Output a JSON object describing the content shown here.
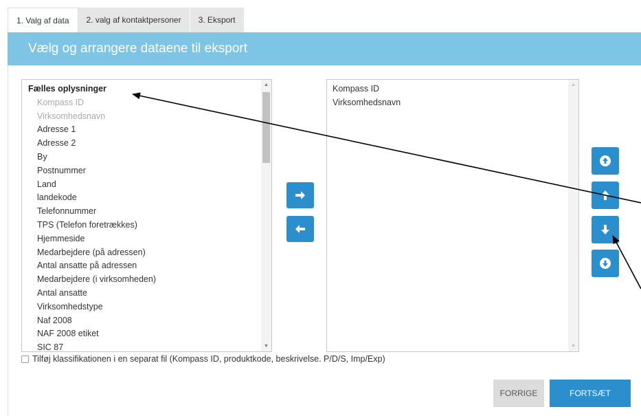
{
  "tabs": [
    {
      "label": "1. Valg af data",
      "active": true
    },
    {
      "label": "2. valg af kontaktpersoner",
      "active": false
    },
    {
      "label": "3. Eksport",
      "active": false
    }
  ],
  "header": {
    "title": "Vælg og arrangere dataene til eksport"
  },
  "available": {
    "group": "Fælles oplysninger",
    "items": [
      {
        "label": "Kompass ID",
        "dim": true
      },
      {
        "label": "Virksomhedsnavn",
        "dim": true
      },
      {
        "label": "Adresse 1"
      },
      {
        "label": "Adresse 2"
      },
      {
        "label": "By"
      },
      {
        "label": "Postnummer"
      },
      {
        "label": "Land"
      },
      {
        "label": "landekode"
      },
      {
        "label": "Telefonnummer"
      },
      {
        "label": "TPS (Telefon foretrækkes)"
      },
      {
        "label": "Hjemmeside"
      },
      {
        "label": "Medarbejdere (på adressen)"
      },
      {
        "label": "Antal ansatte på adressen"
      },
      {
        "label": "Medarbejdere (i virksomheden)"
      },
      {
        "label": "Antal ansatte"
      },
      {
        "label": "Virksomhedstype"
      },
      {
        "label": "Naf 2008"
      },
      {
        "label": "NAF 2008 etiket"
      },
      {
        "label": "SIC 87"
      }
    ]
  },
  "selected": {
    "items": [
      {
        "label": "Kompass ID"
      },
      {
        "label": "Virksomhedsnavn"
      }
    ]
  },
  "icons": {
    "move_right": "arrow-right-icon",
    "move_left": "arrow-left-icon",
    "move_top": "arrow-circle-up-icon",
    "move_up": "arrow-up-icon",
    "move_down": "arrow-down-icon",
    "move_bottom": "arrow-circle-down-icon"
  },
  "checkbox": {
    "label": "Tilføj klassifikationen i en separat fil (Kompass ID, produktkode, beskrivelse. P/D/S, Imp/Exp)",
    "checked": false
  },
  "buttons": {
    "prev": "FORRIGE",
    "next": "FORTSÆT"
  },
  "colors": {
    "header": "#7dc4e5",
    "accent": "#2b8fce",
    "prev_button": "#dcdcdc"
  }
}
